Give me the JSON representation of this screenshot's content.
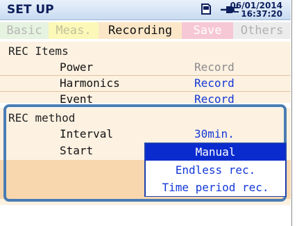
{
  "header": {
    "title": "SET UP",
    "date": "06/01/2014",
    "time": "16:37:20",
    "icons": [
      "memory-card-icon",
      "power-plug-icon"
    ]
  },
  "tabs": [
    {
      "label": "Basic"
    },
    {
      "label": "Meas."
    },
    {
      "label": "Recording",
      "active": true
    },
    {
      "label": "Save"
    },
    {
      "label": "Others"
    }
  ],
  "rec_items": {
    "title": "REC Items",
    "rows": [
      {
        "label": "Power",
        "value": "Record"
      },
      {
        "label": "Harmonics",
        "value": "Record"
      },
      {
        "label": "Event",
        "value": "Record"
      }
    ]
  },
  "rec_method": {
    "title": "REC method",
    "interval_label": "Interval",
    "interval_value": "30min.",
    "start_label": "Start"
  },
  "start_dropdown": {
    "options": [
      "Manual",
      "Endless rec.",
      "Time period rec."
    ],
    "selected": "Manual"
  },
  "colors": {
    "title_text": "#0d1f5c",
    "value_blue": "#1237d8",
    "value_gray": "#8c8c8c",
    "highlight_border": "#4a7db3",
    "selected_option": "#0a2ccf"
  }
}
